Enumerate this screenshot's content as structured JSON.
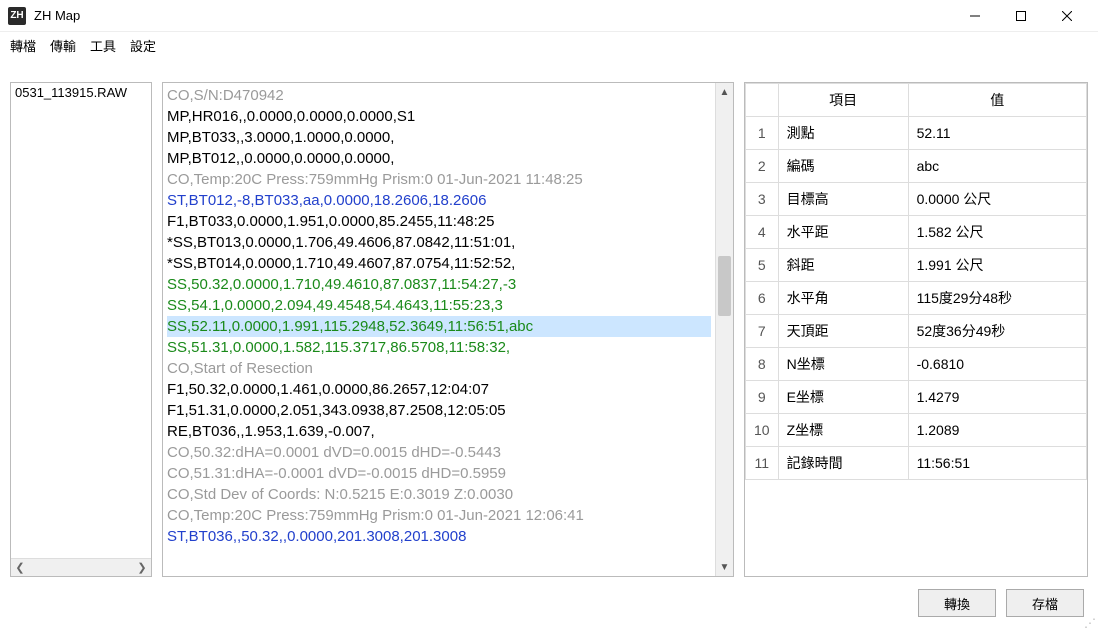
{
  "window": {
    "title": "ZH Map",
    "icon_text": "ZH"
  },
  "menu": {
    "items": [
      "轉檔",
      "傳輸",
      "工具",
      "設定"
    ]
  },
  "files": {
    "items": [
      "0531_113915.RAW"
    ]
  },
  "log": {
    "lines": [
      {
        "text": "CO,S/N:D470942",
        "cls": "gray"
      },
      {
        "text": "MP,HR016,,0.0000,0.0000,0.0000,S1",
        "cls": "black"
      },
      {
        "text": "MP,BT033,,3.0000,1.0000,0.0000,",
        "cls": "black"
      },
      {
        "text": "MP,BT012,,0.0000,0.0000,0.0000,",
        "cls": "black"
      },
      {
        "text": "CO,Temp:20C Press:759mmHg Prism:0 01-Jun-2021 11:48:25",
        "cls": "gray"
      },
      {
        "text": "ST,BT012,-8,BT033,aa,0.0000,18.2606,18.2606",
        "cls": "blue"
      },
      {
        "text": "F1,BT033,0.0000,1.951,0.0000,85.2455,11:48:25",
        "cls": "black"
      },
      {
        "text": "*SS,BT013,0.0000,1.706,49.4606,87.0842,11:51:01,",
        "cls": "black"
      },
      {
        "text": "*SS,BT014,0.0000,1.710,49.4607,87.0754,11:52:52,",
        "cls": "black"
      },
      {
        "text": "SS,50.32,0.0000,1.710,49.4610,87.0837,11:54:27,-3",
        "cls": "green"
      },
      {
        "text": "SS,54.1,0.0000,2.094,49.4548,54.4643,11:55:23,3",
        "cls": "green"
      },
      {
        "text": "SS,52.11,0.0000,1.991,115.2948,52.3649,11:56:51,abc",
        "cls": "green sel"
      },
      {
        "text": "SS,51.31,0.0000,1.582,115.3717,86.5708,11:58:32,",
        "cls": "green"
      },
      {
        "text": "CO,Start of Resection",
        "cls": "gray"
      },
      {
        "text": "F1,50.32,0.0000,1.461,0.0000,86.2657,12:04:07",
        "cls": "black"
      },
      {
        "text": "F1,51.31,0.0000,2.051,343.0938,87.2508,12:05:05",
        "cls": "black"
      },
      {
        "text": "RE,BT036,,1.953,1.639,-0.007,",
        "cls": "black"
      },
      {
        "text": "CO,50.32:dHA=0.0001 dVD=0.0015 dHD=-0.5443",
        "cls": "gray"
      },
      {
        "text": "CO,51.31:dHA=-0.0001 dVD=-0.0015 dHD=0.5959",
        "cls": "gray"
      },
      {
        "text": "CO,Std Dev of Coords: N:0.5215 E:0.3019 Z:0.0030",
        "cls": "gray"
      },
      {
        "text": "CO,Temp:20C Press:759mmHg Prism:0 01-Jun-2021 12:06:41",
        "cls": "gray"
      },
      {
        "text": "ST,BT036,,50.32,,0.0000,201.3008,201.3008",
        "cls": "blue"
      }
    ]
  },
  "details": {
    "headers": {
      "item": "項目",
      "value": "值"
    },
    "rows": [
      {
        "n": "1",
        "k": "測點",
        "v": "52.11"
      },
      {
        "n": "2",
        "k": "編碼",
        "v": "abc"
      },
      {
        "n": "3",
        "k": "目標高",
        "v": "0.0000 公尺"
      },
      {
        "n": "4",
        "k": "水平距",
        "v": "1.582 公尺"
      },
      {
        "n": "5",
        "k": "斜距",
        "v": "1.991 公尺"
      },
      {
        "n": "6",
        "k": "水平角",
        "v": "115度29分48秒"
      },
      {
        "n": "7",
        "k": "天頂距",
        "v": "52度36分49秒"
      },
      {
        "n": "8",
        "k": "N坐標",
        "v": "-0.6810"
      },
      {
        "n": "9",
        "k": "E坐標",
        "v": "1.4279"
      },
      {
        "n": "10",
        "k": "Z坐標",
        "v": "1.2089"
      },
      {
        "n": "11",
        "k": "記錄時間",
        "v": "11:56:51"
      }
    ]
  },
  "buttons": {
    "convert": "轉換",
    "save": "存檔"
  },
  "scroll": {
    "left": "❮",
    "right": "❯",
    "up": "▲",
    "down": "▼"
  }
}
